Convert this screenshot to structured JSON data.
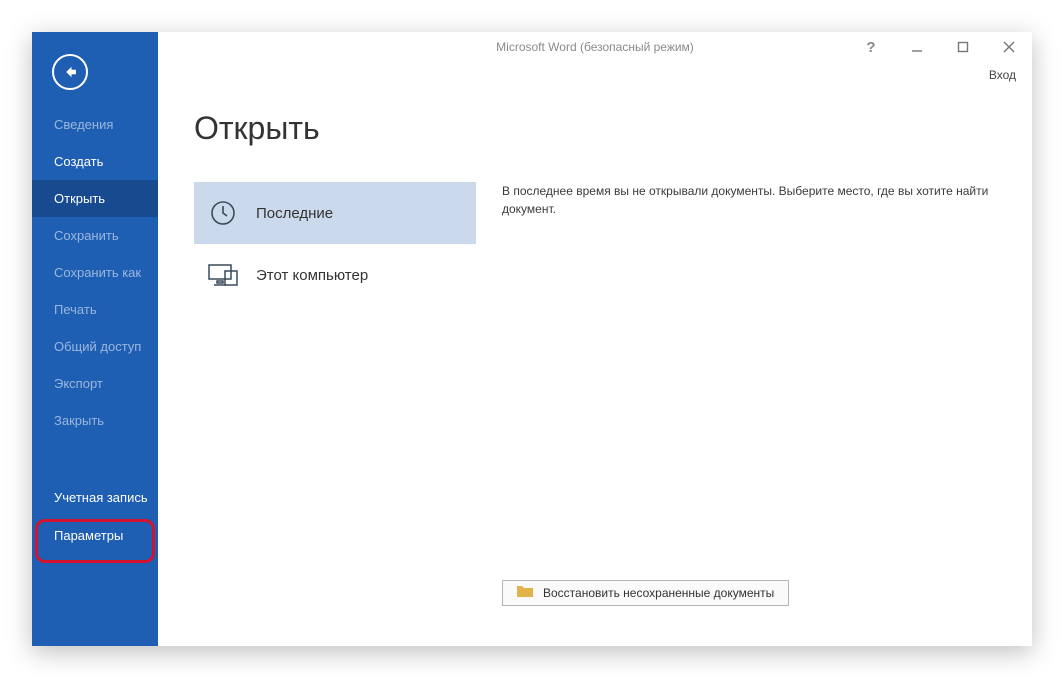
{
  "window": {
    "title": "Microsoft Word (безопасный режим)",
    "signin_label": "Вход"
  },
  "sidebar": {
    "items": [
      {
        "label": "Сведения",
        "enabled": false,
        "selected": false
      },
      {
        "label": "Создать",
        "enabled": true,
        "selected": false
      },
      {
        "label": "Открыть",
        "enabled": true,
        "selected": true
      },
      {
        "label": "Сохранить",
        "enabled": false,
        "selected": false
      },
      {
        "label": "Сохранить как",
        "enabled": false,
        "selected": false
      },
      {
        "label": "Печать",
        "enabled": false,
        "selected": false
      },
      {
        "label": "Общий доступ",
        "enabled": false,
        "selected": false
      },
      {
        "label": "Экспорт",
        "enabled": false,
        "selected": false
      },
      {
        "label": "Закрыть",
        "enabled": false,
        "selected": false
      }
    ],
    "account_label": "Учетная запись",
    "options_label": "Параметры"
  },
  "page": {
    "title": "Открыть",
    "places": [
      {
        "key": "recent",
        "label": "Последние",
        "selected": true
      },
      {
        "key": "this_pc",
        "label": "Этот компьютер",
        "selected": false
      }
    ],
    "empty_message": "В последнее время вы не открывали документы. Выберите место, где вы хотите найти документ.",
    "recover_button": "Восстановить несохраненные документы"
  }
}
